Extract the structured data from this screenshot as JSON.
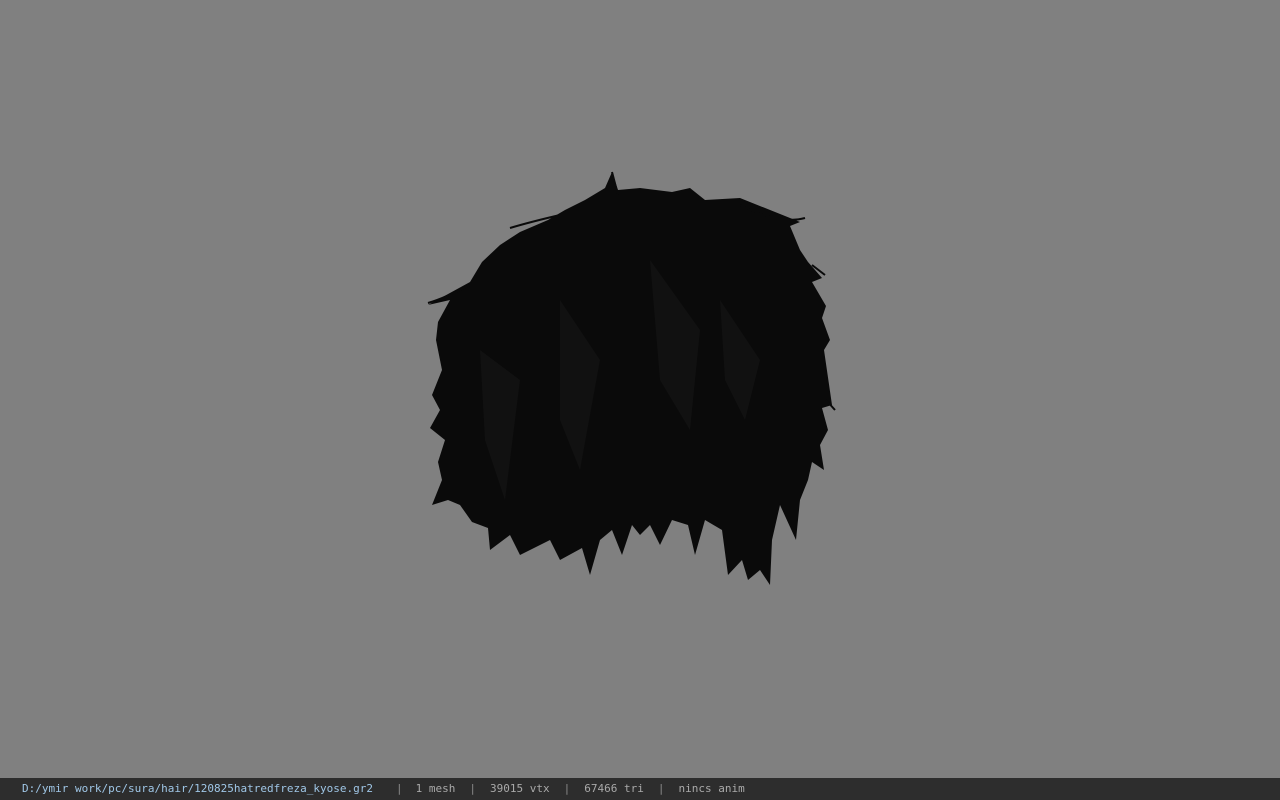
{
  "viewer": {
    "background_color": "#808080",
    "model": {
      "name": "hair-mesh",
      "hair_color": "#0a0a0a",
      "skin_color": "#5a3a2e"
    }
  },
  "status_bar": {
    "file_path": "D:/ymir work/pc/sura/hair/120825hatredfreza_kyose.gr2",
    "separator": "|",
    "mesh_count": "1 mesh",
    "vertex_count": "39015 vtx",
    "triangle_count": "67466 tri",
    "anim_status": "nincs anim",
    "background_color": "#2d2d2d",
    "text_color": "#a9a9a9",
    "path_color": "#9fc6e6"
  }
}
